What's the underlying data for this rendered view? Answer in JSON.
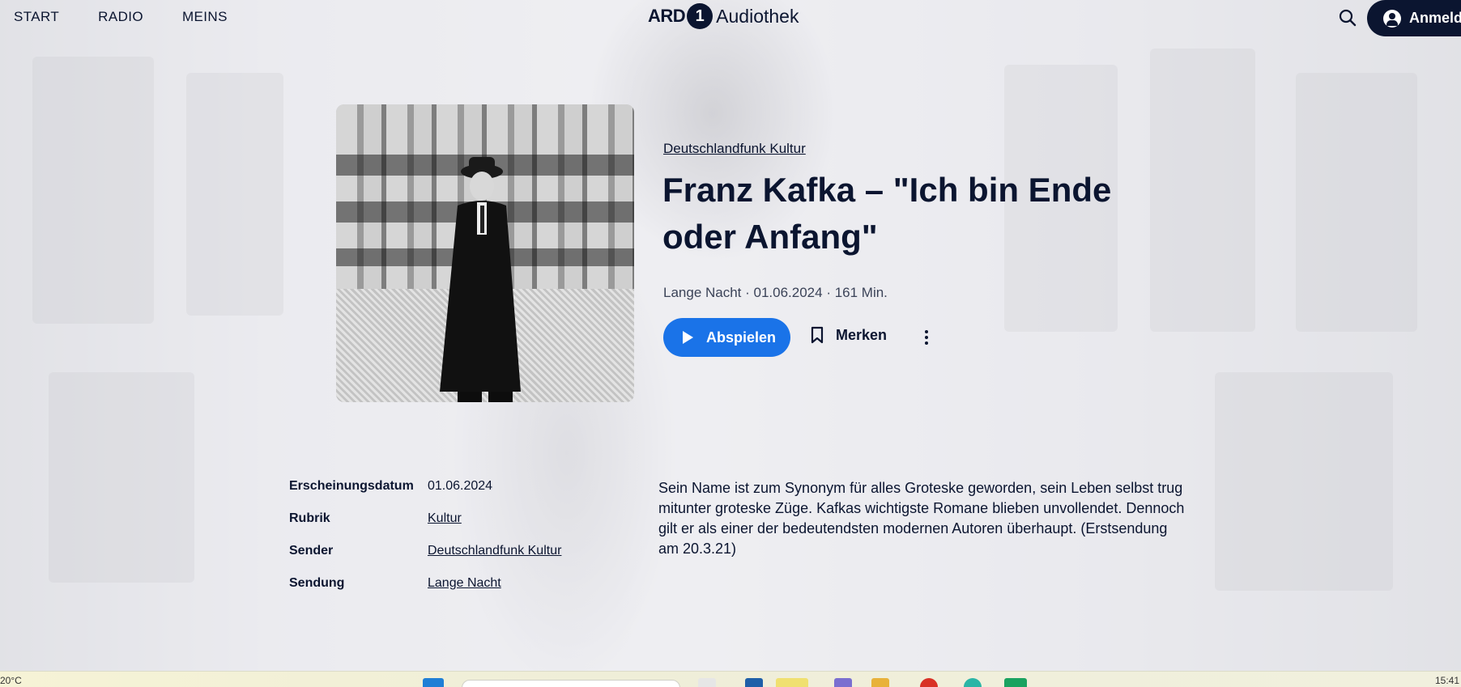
{
  "nav": {
    "items": [
      "START",
      "RADIO",
      "MEINS"
    ],
    "logo_prefix": "ARD",
    "logo_one": "1",
    "logo_name": "Audiothek",
    "login_label": "Anmeld"
  },
  "episode": {
    "kicker": "Deutschlandfunk Kultur",
    "title": "Franz Kafka – \"Ich bin Ende oder Anfang\"",
    "meta": "Lange Nacht · 01.06.2024 · 161 Min.",
    "play_label": "Abspielen",
    "bookmark_label": "Merken"
  },
  "details": [
    {
      "key": "Erscheinungsdatum",
      "value": "01.06.2024",
      "link": false
    },
    {
      "key": "Rubrik",
      "value": "Kultur",
      "link": true
    },
    {
      "key": "Sender",
      "value": "Deutschlandfunk Kultur",
      "link": true
    },
    {
      "key": "Sendung",
      "value": "Lange Nacht",
      "link": true
    }
  ],
  "description": "Sein Name ist zum Synonym für alles Groteske geworden, sein Leben selbst trug mitunter groteske Züge. Kafkas wichtigste Romane blieben unvollendet. Dennoch gilt er als einer der bedeutendsten modernen Autoren überhaupt. (Erstsendung am 20.3.21)",
  "taskbar": {
    "temperature": "20°C",
    "clock": "15:41"
  },
  "colors": {
    "accent": "#1a73e8",
    "navy": "#0b1530"
  }
}
